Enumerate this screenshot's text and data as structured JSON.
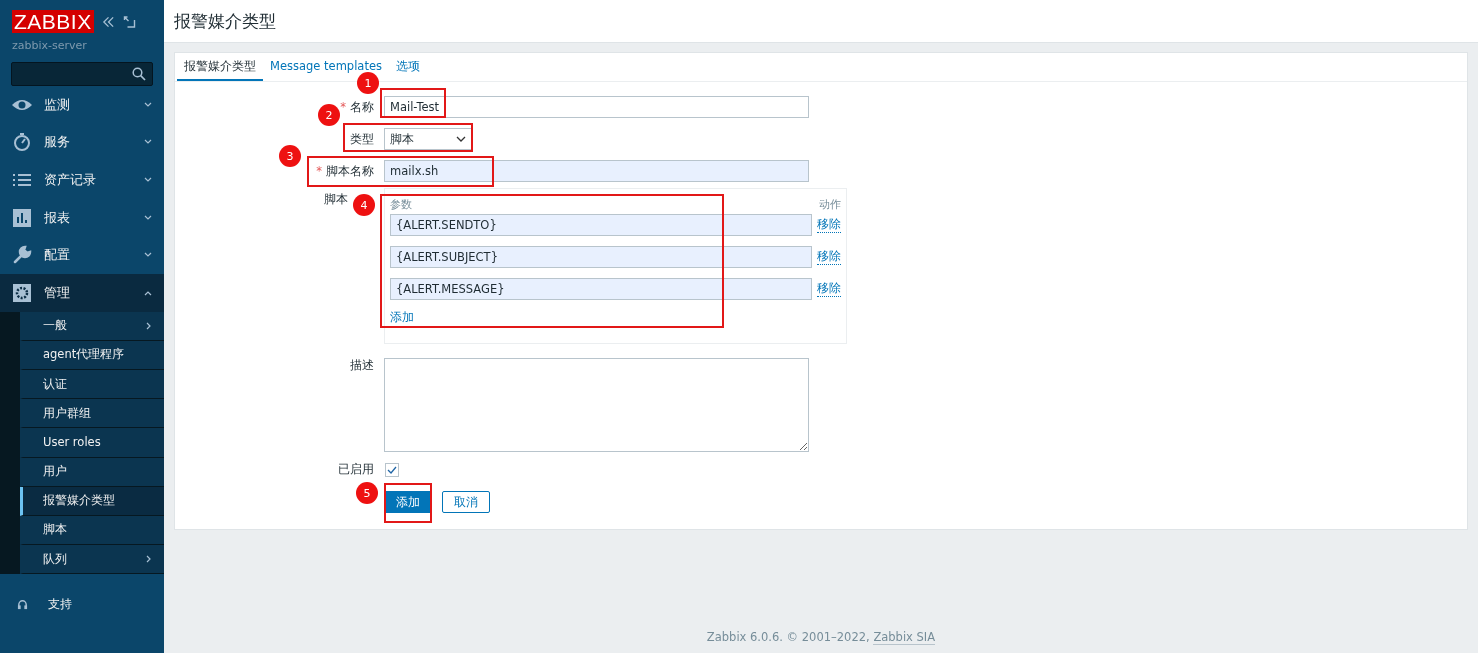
{
  "sidebar": {
    "logo": "ZABBIX",
    "server": "zabbix-server",
    "menu": [
      {
        "label": "监测",
        "expanded": false,
        "selected": false
      },
      {
        "label": "服务",
        "expanded": false,
        "selected": false
      },
      {
        "label": "资产记录",
        "expanded": false,
        "selected": false
      },
      {
        "label": "报表",
        "expanded": false,
        "selected": false
      },
      {
        "label": "配置",
        "expanded": false,
        "selected": false
      },
      {
        "label": "管理",
        "expanded": true,
        "selected": true,
        "children": [
          {
            "label": "一般",
            "has_submenu": true,
            "selected": false
          },
          {
            "label": "agent代理程序",
            "has_submenu": false,
            "selected": false
          },
          {
            "label": "认证",
            "has_submenu": false,
            "selected": false
          },
          {
            "label": "用户群组",
            "has_submenu": false,
            "selected": false
          },
          {
            "label": "User roles",
            "has_submenu": false,
            "selected": false
          },
          {
            "label": "用户",
            "has_submenu": false,
            "selected": false
          },
          {
            "label": "报警媒介类型",
            "has_submenu": false,
            "selected": true
          },
          {
            "label": "脚本",
            "has_submenu": false,
            "selected": false
          },
          {
            "label": "队列",
            "has_submenu": true,
            "selected": false
          }
        ]
      }
    ],
    "support": "支持"
  },
  "page_title": "报警媒介类型",
  "tabs": [
    {
      "label": "报警媒介类型",
      "selected": true
    },
    {
      "label": "Message templates",
      "selected": false
    },
    {
      "label": "选项",
      "selected": false
    }
  ],
  "form": {
    "name": {
      "label": "名称",
      "required_mark": "*",
      "value": "Mail-Test"
    },
    "type": {
      "label": "类型",
      "value": "脚本"
    },
    "script_name": {
      "label": "脚本名称",
      "required_mark": "*",
      "value": "mailx.sh"
    },
    "params": {
      "label": "脚本",
      "column_1": "参数",
      "column_2": "动作",
      "rows": [
        {
          "value": "{ALERT.SENDTO}",
          "action": "移除"
        },
        {
          "value": "{ALERT.SUBJECT}",
          "action": "移除"
        },
        {
          "value": "{ALERT.MESSAGE}",
          "action": "移除"
        }
      ],
      "add": "添加"
    },
    "description": {
      "label": "描述"
    },
    "enabled": {
      "label": "已启用",
      "checked": true
    },
    "buttons": {
      "add": "添加",
      "cancel": "取消"
    }
  },
  "footer": {
    "text": "Zabbix 6.0.6. © 2001–2022, ",
    "link": "Zabbix SIA"
  },
  "annotations": [
    {
      "number": "1"
    },
    {
      "number": "2"
    },
    {
      "number": "3"
    },
    {
      "number": "4"
    },
    {
      "number": "5"
    }
  ]
}
